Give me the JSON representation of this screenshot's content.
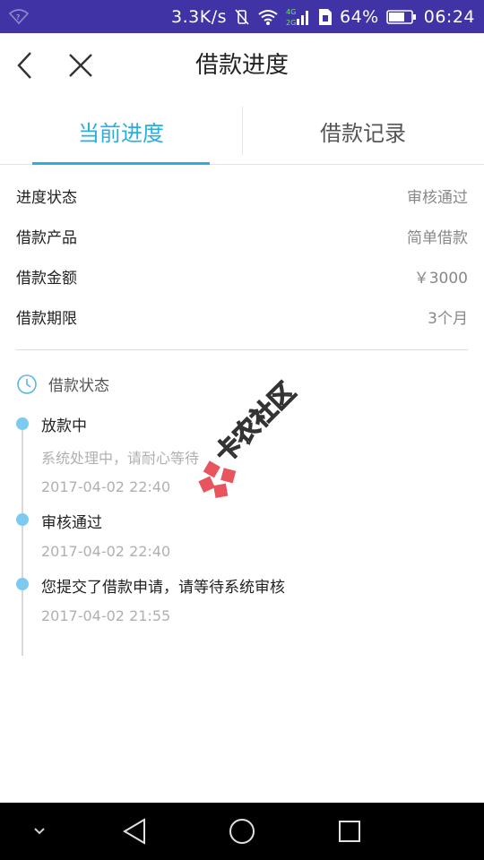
{
  "status_bar": {
    "network_speed": "3.3K/s",
    "battery": "64%",
    "time": "06:24",
    "signal_label_top": "4G",
    "signal_label_bottom": "2G"
  },
  "header": {
    "title": "借款进度",
    "back_icon": "chevron-left-icon",
    "close_icon": "close-icon"
  },
  "tabs": [
    {
      "label": "当前进度",
      "active": true
    },
    {
      "label": "借款记录",
      "active": false
    }
  ],
  "info_rows": [
    {
      "label": "进度状态",
      "value": "审核通过"
    },
    {
      "label": "借款产品",
      "value": "简单借款"
    },
    {
      "label": "借款金额",
      "value": "￥3000"
    },
    {
      "label": "借款期限",
      "value": "3个月"
    }
  ],
  "status_section": {
    "title": "借款状态",
    "icon": "clock-icon"
  },
  "timeline": [
    {
      "title": "放款中",
      "desc": "系统处理中，请耐心等待",
      "time": "2017-04-02 22:40"
    },
    {
      "title": "审核通过",
      "time": "2017-04-02 22:40"
    },
    {
      "title": "您提交了借款申请，请等待系统审核",
      "time": "2017-04-02 21:55"
    }
  ],
  "watermark": {
    "text": "卡农社区"
  },
  "colors": {
    "status_bar": "#3f33a6",
    "accent": "#29aee0",
    "timeline_dot": "#7ccaf0",
    "watermark": "#e8555f"
  }
}
